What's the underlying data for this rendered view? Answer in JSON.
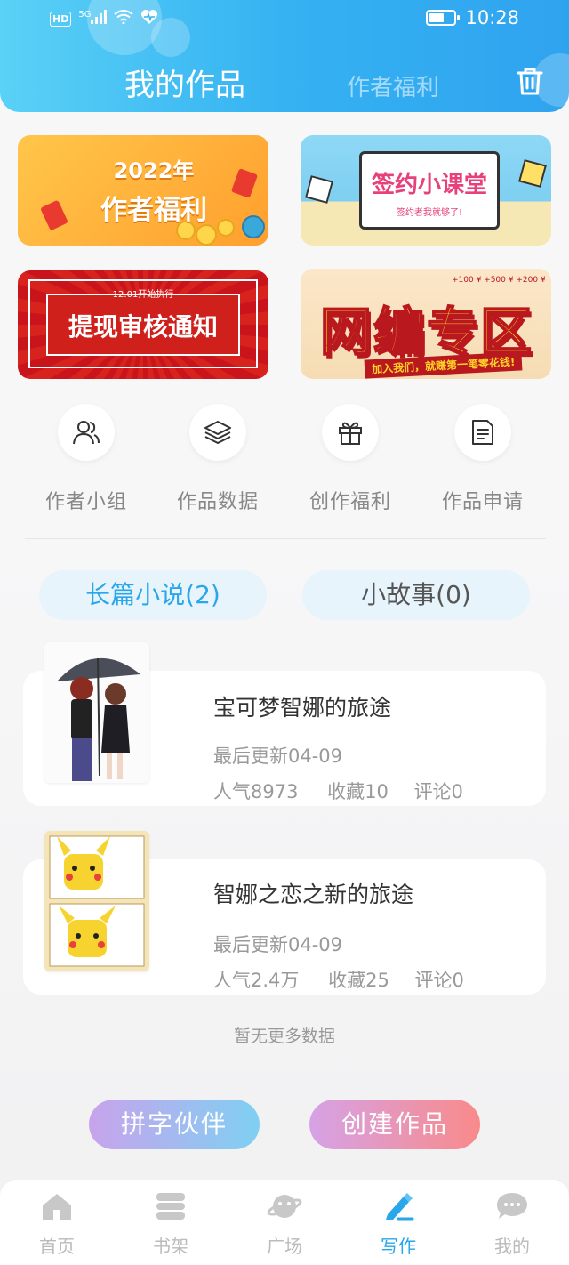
{
  "status_bar": {
    "network_badge": "HD",
    "signal_label": "5G",
    "battery_level": 0.6,
    "time": "10:28"
  },
  "header": {
    "tabs": [
      {
        "label": "我的作品",
        "active": true
      },
      {
        "label": "作者福利",
        "active": false
      }
    ],
    "trash_icon": "trash-icon"
  },
  "banners": [
    {
      "year": "2022年",
      "title": "作者福利"
    },
    {
      "title": "签约小课堂",
      "subtitle": "签约者我就够了!"
    },
    {
      "date_note": "12.01开始执行",
      "title": "提现审核通知"
    },
    {
      "title": "网编专区",
      "ribbon": "加入我们，就赚第一笔零花钱!",
      "bonus": "+100 ¥ +500 ¥ +200 ¥"
    }
  ],
  "quick_menu": [
    {
      "label": "作者小组",
      "icon": "people-icon"
    },
    {
      "label": "作品数据",
      "icon": "layers-icon"
    },
    {
      "label": "创作福利",
      "icon": "gift-icon"
    },
    {
      "label": "作品申请",
      "icon": "document-icon"
    }
  ],
  "categories": [
    {
      "label": "长篇小说(2)",
      "active": true
    },
    {
      "label": "小故事(0)",
      "active": false
    }
  ],
  "works": [
    {
      "title": "宝可梦智娜的旅途",
      "updated": "最后更新04-09",
      "popularity": "人气8973",
      "favorites": "收藏10",
      "comments": "评论0",
      "cover": "anime-couple-umbrella-cover"
    },
    {
      "title": "智娜之恋之新的旅途",
      "updated": "最后更新04-09",
      "popularity": "人气2.4万",
      "favorites": "收藏25",
      "comments": "评论0",
      "cover": "pikachu-comic-cover"
    }
  ],
  "no_more_text": "暂无更多数据",
  "actions": {
    "partner": "拼字伙伴",
    "create": "创建作品"
  },
  "bottom_nav": [
    {
      "label": "首页",
      "icon": "home-icon",
      "active": false
    },
    {
      "label": "书架",
      "icon": "bookshelf-icon",
      "active": false
    },
    {
      "label": "广场",
      "icon": "planet-icon",
      "active": false
    },
    {
      "label": "写作",
      "icon": "pen-icon",
      "active": true
    },
    {
      "label": "我的",
      "icon": "chat-bubble-icon",
      "active": false
    }
  ],
  "colors": {
    "header_gradient_start": "#5ad1f6",
    "header_gradient_end": "#2fa3ef",
    "accent": "#2aa6ea",
    "inactive_text": "#bbbbbb"
  }
}
